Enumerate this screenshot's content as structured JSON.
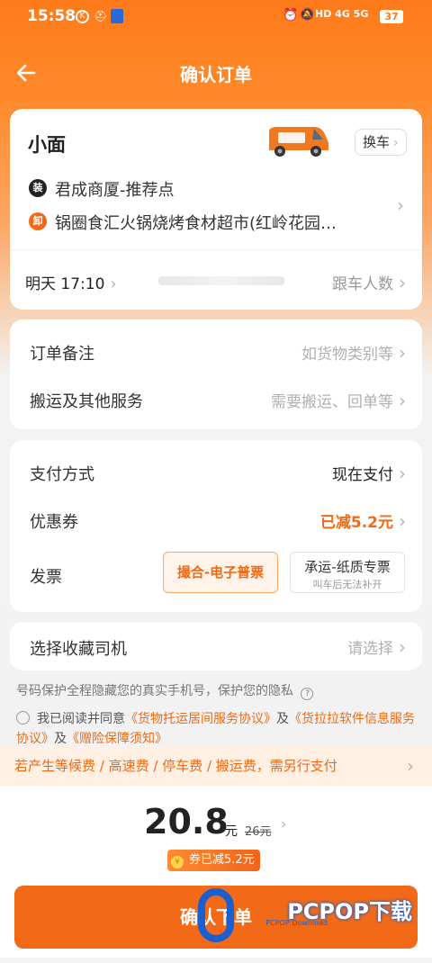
{
  "status": {
    "time": "15:58",
    "icons": [
      "k-icon",
      "hat-icon",
      "app-icon"
    ],
    "right": "HD 4G 5G",
    "battery": "37"
  },
  "header": {
    "title": "确认订单",
    "back_icon": "arrow-left-icon"
  },
  "vehicle": {
    "name": "小面",
    "swap_label": "换车",
    "pickup_badge": "装",
    "pickup": "君成商厦-推荐点",
    "drop_badge": "卸",
    "drop": "锅圈食汇火锅烧烤食材超市(红岭花园…",
    "time_label": "明天 17:10",
    "riders_label": "跟车人数"
  },
  "notes": {
    "remark_label": "订单备注",
    "remark_placeholder": "如货物类别等",
    "service_label": "搬运及其他服务",
    "service_placeholder": "需要搬运、回单等"
  },
  "payment": {
    "method_label": "支付方式",
    "method_value": "现在支付",
    "coupon_label": "优惠券",
    "coupon_value": "已减5.2元",
    "invoice_label": "发票",
    "invoice_option1": "撮合-电子普票",
    "invoice_option2": "承运-纸质专票",
    "invoice_option2_sub": "叫车后无法补开"
  },
  "driver": {
    "label": "选择收藏司机",
    "placeholder": "请选择"
  },
  "privacy_text": "号码保护全程隐藏您的真实手机号，保护您的隐私",
  "agreement": {
    "prefix": "我已阅读并同意",
    "link1": "《货物托运居间服务协议》",
    "and1": "及",
    "link2": "《货拉拉软件信息服务协议》",
    "and2": "及",
    "link3": "《赠险保障须知》"
  },
  "banner": "若产生等候费 / 高速费 / 停车费 / 搬运费，需另行支付",
  "price": {
    "amount": "20.8",
    "unit": "元",
    "original": "26元",
    "coupon_badge": "券已减5.2元"
  },
  "confirm_label": "确认下单",
  "watermark": {
    "text": "PCPOP下载",
    "sub": "PCPOP Download"
  },
  "colors": {
    "accent": "#f26a18",
    "header": "#ff7a1a"
  }
}
